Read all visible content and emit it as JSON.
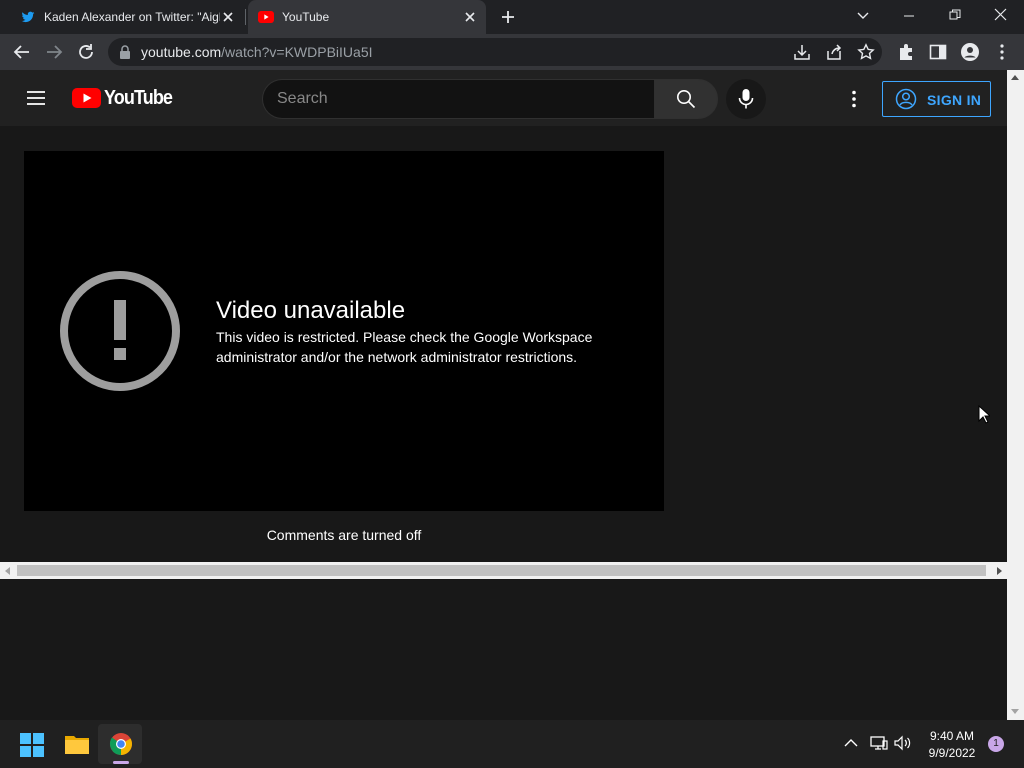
{
  "browser": {
    "tabs": [
      {
        "title": "Kaden Alexander on Twitter: \"Aight"
      },
      {
        "title": "YouTube"
      }
    ],
    "url_host": "youtube.com",
    "url_path": "/watch?v=KWDPBiIUa5I"
  },
  "youtube": {
    "logo_text": "YouTube",
    "search_placeholder": "Search",
    "signin_label": "SIGN IN",
    "error_title": "Video unavailable",
    "error_message": "This video is restricted. Please check the Google Workspace administrator and/or the network administrator restrictions.",
    "comments_status": "Comments are turned off"
  },
  "taskbar": {
    "time": "9:40 AM",
    "date": "9/9/2022",
    "notification_count": "1"
  },
  "colors": {
    "accent_blue": "#3ea6ff",
    "youtube_red": "#ff0000",
    "page_bg": "#181818"
  }
}
